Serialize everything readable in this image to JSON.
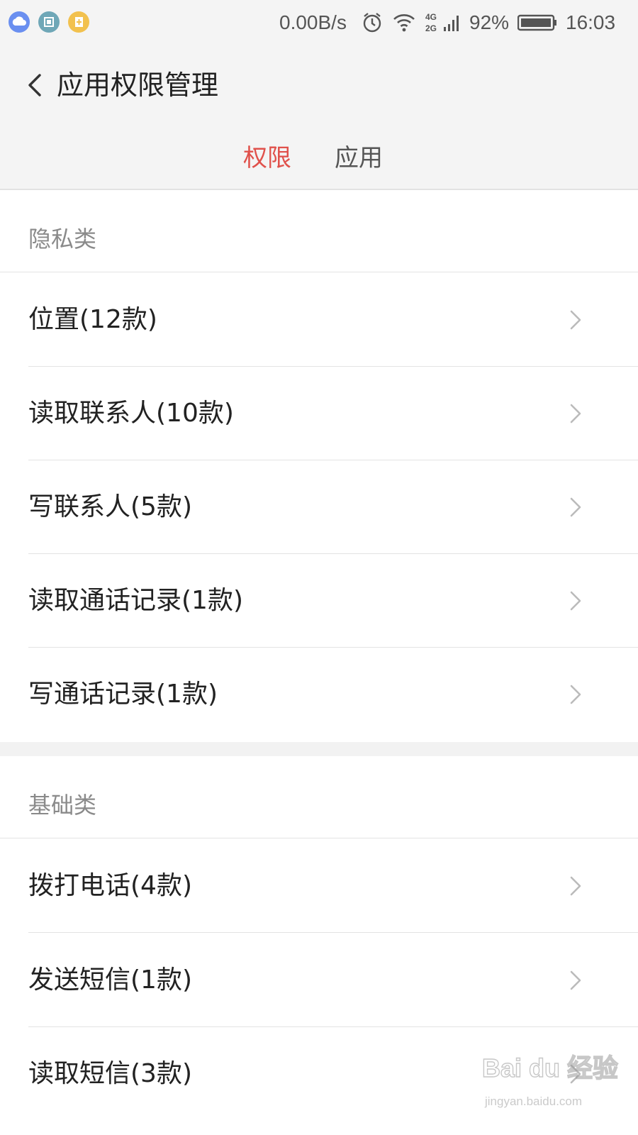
{
  "status_bar": {
    "net_speed": "0.00B/s",
    "network_labels": [
      "4G",
      "2G"
    ],
    "battery": "92%",
    "time": "16:03",
    "icons": [
      "cloud-icon",
      "screenshot-icon",
      "file-icon",
      "alarm-icon",
      "wifi-icon",
      "signal-icon",
      "battery-icon"
    ]
  },
  "header": {
    "title": "应用权限管理",
    "tabs": [
      {
        "label": "权限",
        "active": true
      },
      {
        "label": "应用",
        "active": false
      }
    ]
  },
  "colors": {
    "accent": "#e0514b",
    "background": "#f4f4f4",
    "section_text": "#8a8a8a"
  },
  "sections": [
    {
      "title": "隐私类",
      "items": [
        {
          "label": "位置(12款)"
        },
        {
          "label": "读取联系人(10款)"
        },
        {
          "label": "写联系人(5款)"
        },
        {
          "label": "读取通话记录(1款)"
        },
        {
          "label": "写通话记录(1款)"
        }
      ]
    },
    {
      "title": "基础类",
      "items": [
        {
          "label": "拨打电话(4款)"
        },
        {
          "label": "发送短信(1款)"
        },
        {
          "label": "读取短信(3款)"
        }
      ]
    }
  ],
  "watermark": {
    "brand": "Bai du 经验",
    "url": "jingyan.baidu.com"
  }
}
